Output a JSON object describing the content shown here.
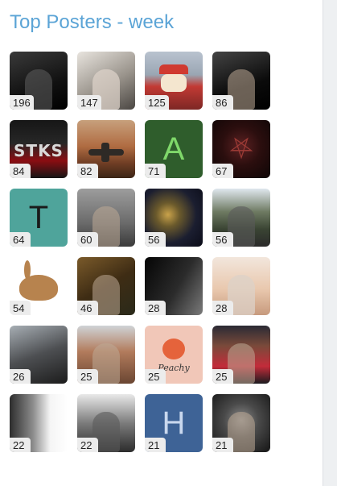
{
  "widget": {
    "title": "Top Posters - week"
  },
  "posters": [
    {
      "count": "196",
      "avatar_icon": "user-avatar-photo"
    },
    {
      "count": "147",
      "avatar_icon": "user-avatar-photo"
    },
    {
      "count": "125",
      "avatar_icon": "user-avatar-photo"
    },
    {
      "count": "86",
      "avatar_icon": "user-avatar-photo"
    },
    {
      "count": "84",
      "avatar_icon": "user-avatar-photo",
      "avatar_text": "STKS"
    },
    {
      "count": "82",
      "avatar_icon": "user-avatar-photo"
    },
    {
      "count": "71",
      "avatar_letter": "A",
      "letter_color": "#7fd86a",
      "avatar_bg": "#2f5d2c"
    },
    {
      "count": "67",
      "avatar_icon": "user-avatar-photo"
    },
    {
      "count": "64",
      "avatar_letter": "T",
      "letter_color": "#1a1a1a",
      "avatar_bg": "#4fa49b"
    },
    {
      "count": "60",
      "avatar_icon": "user-avatar-photo"
    },
    {
      "count": "56",
      "avatar_icon": "user-avatar-photo"
    },
    {
      "count": "56",
      "avatar_icon": "user-avatar-photo"
    },
    {
      "count": "54",
      "avatar_icon": "user-avatar-photo"
    },
    {
      "count": "46",
      "avatar_icon": "user-avatar-photo"
    },
    {
      "count": "28",
      "avatar_icon": "user-avatar-photo"
    },
    {
      "count": "28",
      "avatar_icon": "user-avatar-photo"
    },
    {
      "count": "26",
      "avatar_icon": "user-avatar-photo"
    },
    {
      "count": "25",
      "avatar_icon": "user-avatar-photo"
    },
    {
      "count": "25",
      "avatar_icon": "user-avatar-photo",
      "avatar_text": "Peachy"
    },
    {
      "count": "25",
      "avatar_icon": "user-avatar-photo"
    },
    {
      "count": "22",
      "avatar_icon": "user-avatar-photo"
    },
    {
      "count": "22",
      "avatar_icon": "user-avatar-photo"
    },
    {
      "count": "21",
      "avatar_letter": "H",
      "letter_color": "#c9d8ee",
      "avatar_bg": "#3e6396"
    },
    {
      "count": "21",
      "avatar_icon": "user-avatar-photo"
    }
  ],
  "colors": {
    "title": "#5ba4d6",
    "badge_bg": "#ececec",
    "panel_bg": "#ffffff",
    "page_bg": "#eef0f2"
  }
}
